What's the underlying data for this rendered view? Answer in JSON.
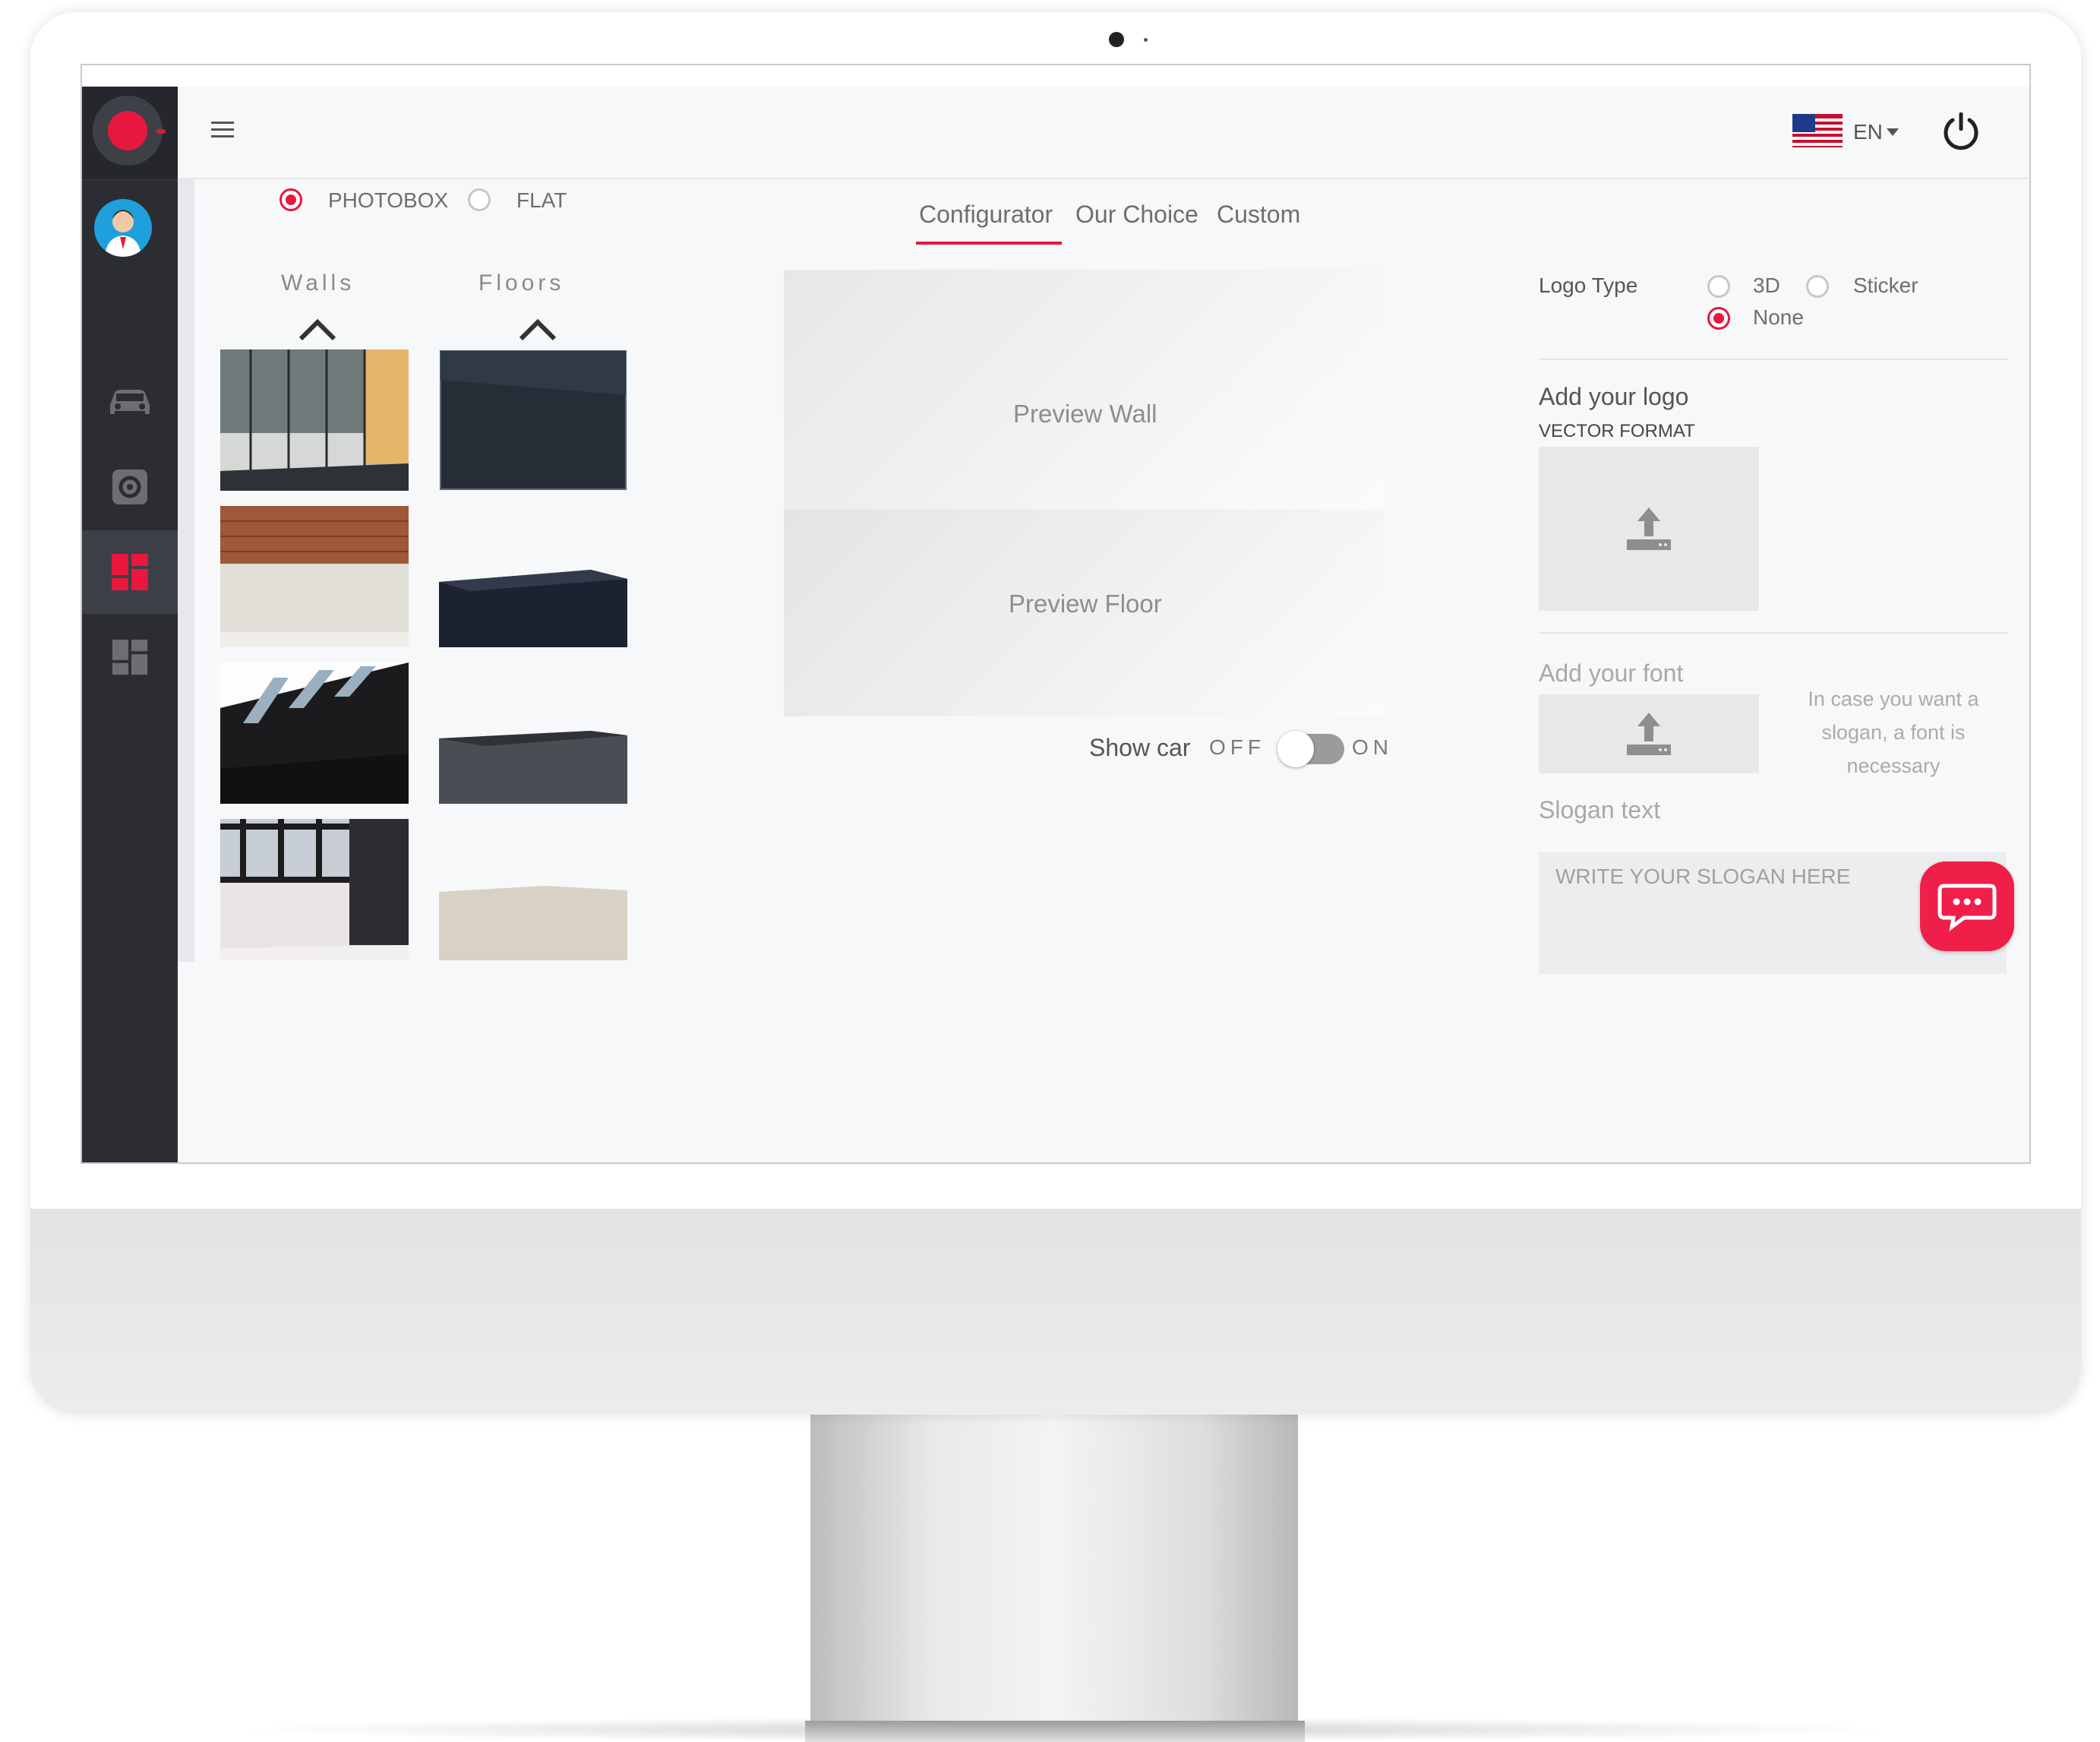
{
  "header": {
    "language": "EN",
    "menu_icon": "hamburger-icon",
    "power_icon": "power-icon",
    "flag_icon": "us-flag-icon"
  },
  "mode": {
    "options": [
      "PHOTOBOX",
      "FLAT"
    ],
    "selected": "PHOTOBOX"
  },
  "tabs": [
    {
      "label": "Configurator",
      "active": true
    },
    {
      "label": "Our Choice",
      "active": false
    },
    {
      "label": "Custom",
      "active": false
    }
  ],
  "library": {
    "walls_label": "Walls",
    "floors_label": "Floors"
  },
  "preview": {
    "wall_label": "Preview Wall",
    "floor_label": "Preview Floor"
  },
  "show_car": {
    "label": "Show car",
    "off_label": "OFF",
    "on_label": "ON",
    "state": "OFF"
  },
  "logo": {
    "type_label": "Logo Type",
    "options": [
      "3D",
      "Sticker",
      "None"
    ],
    "selected": "None",
    "add_label": "Add your logo",
    "format_note": "VECTOR FORMAT"
  },
  "font": {
    "add_label": "Add your font",
    "hint": "In case you want a slogan, a font is necessary"
  },
  "slogan": {
    "label": "Slogan text",
    "placeholder": "WRITE YOUR SLOGAN HERE"
  },
  "colors": {
    "accent": "#e8173d",
    "sidebar": "#2b2d33",
    "avatar": "#1fa0dc"
  },
  "sidebar_icons": [
    "car-icon",
    "gear-icon",
    "dashboard-icon",
    "grid-icon"
  ]
}
